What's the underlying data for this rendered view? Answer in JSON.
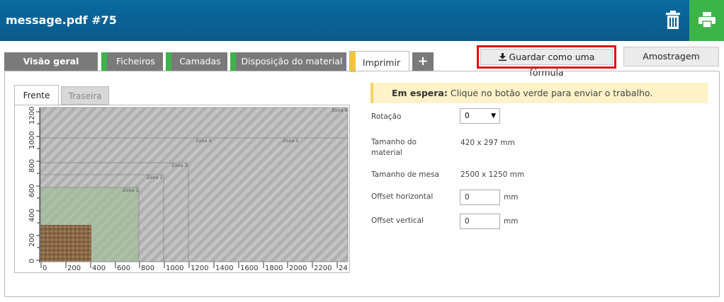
{
  "header": {
    "title": "message.pdf #75"
  },
  "tabs": [
    {
      "label": "Visão geral"
    },
    {
      "label": "Ficheiros"
    },
    {
      "label": "Camadas"
    },
    {
      "label": "Disposição do material"
    },
    {
      "label": "Imprimir"
    },
    {
      "label": "+"
    }
  ],
  "buttons": {
    "save_formula": "Guardar como uma fórmula",
    "sampling": "Amostragem"
  },
  "preview": {
    "tabs": [
      "Frente",
      "Traseira"
    ],
    "zones": [
      "Zona 1",
      "Zona 2",
      "Zona 3",
      "Zona 4",
      "Zona 5",
      "Zona 6"
    ],
    "x_ticks": [
      "0",
      "200",
      "400",
      "600",
      "800",
      "1000",
      "1200",
      "1400",
      "1600",
      "1800",
      "2000",
      "2200",
      "24"
    ],
    "y_ticks": [
      "0",
      "200",
      "400",
      "600",
      "800",
      "1000",
      "1200"
    ]
  },
  "notice": {
    "status": "Em espera:",
    "message": "Clique no botão verde para enviar o trabalho."
  },
  "form": {
    "rotation_label": "Rotação",
    "rotation_value": "0",
    "material_size_label": "Tamanho do material",
    "material_size_value": "420 x 297 mm",
    "table_size_label": "Tamanho de mesa",
    "table_size_value": "2500 x 1250 mm",
    "offset_h_label": "Offset horizontal",
    "offset_h_value": "0",
    "offset_v_label": "Offset vertical",
    "offset_v_value": "0",
    "unit": "mm"
  },
  "colors": {
    "header": "#0a5a8a",
    "accent_green": "#3cb44a",
    "active_tab": "#f5c33b",
    "highlight": "#e01010"
  },
  "icons": {
    "delete": "trash-icon",
    "print": "printer-icon",
    "download": "download-icon",
    "add": "plus-icon",
    "dropdown": "chevron-down-icon"
  }
}
